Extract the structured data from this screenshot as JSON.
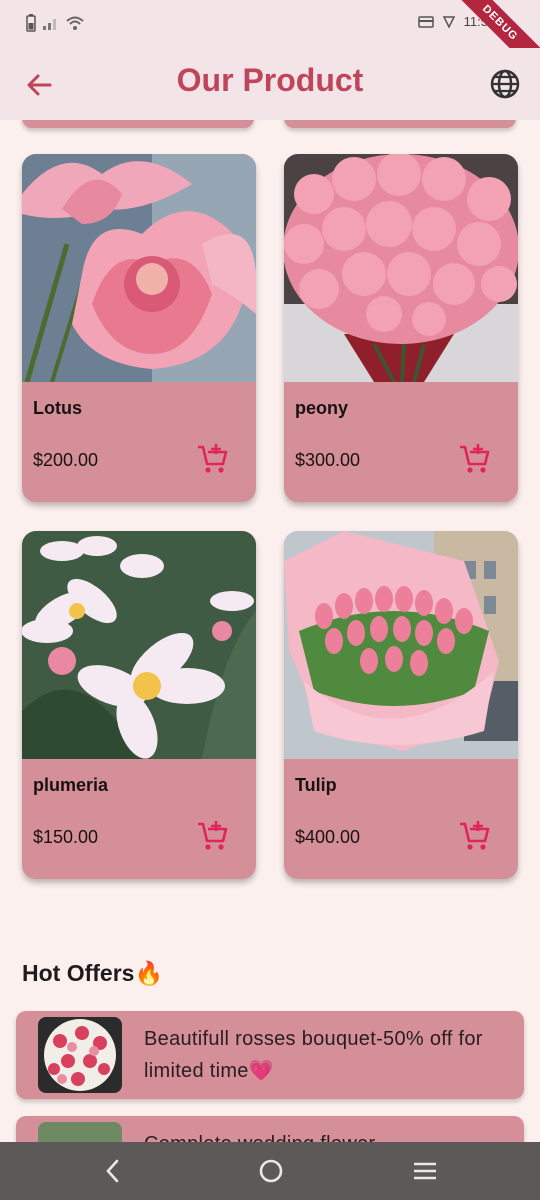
{
  "status_bar": {
    "time": "11:5"
  },
  "debug_banner": "DEBUG",
  "app_bar": {
    "title": "Our Product",
    "back_icon": "arrow-left-icon",
    "language_icon": "globe-icon"
  },
  "products": [
    {
      "name": "Lotus",
      "price": "$200.00",
      "image": "lotus-photo"
    },
    {
      "name": "peony",
      "price": "$300.00",
      "image": "peony-photo"
    },
    {
      "name": "plumeria",
      "price": "$150.00",
      "image": "plumeria-photo"
    },
    {
      "name": "Tulip",
      "price": "$400.00",
      "image": "tulip-photo"
    }
  ],
  "hot_offers": {
    "title": "Hot Offers🔥",
    "items": [
      {
        "text": "Beautifull rosses bouquet-50% off for limited time💗",
        "image": "roses-bouquet-photo"
      },
      {
        "text": "Complete wedding flower arrangements at special prices",
        "image": "wedding-flowers-photo"
      }
    ]
  },
  "colors": {
    "accent": "#c0455b",
    "card": "#d48f99",
    "background": "#fcf0ee",
    "appbar": "#f3e4e7",
    "cart_icon": "#e0245e"
  },
  "nav": {
    "back": "nav-back-icon",
    "home": "nav-home-icon",
    "recents": "nav-recents-icon"
  }
}
